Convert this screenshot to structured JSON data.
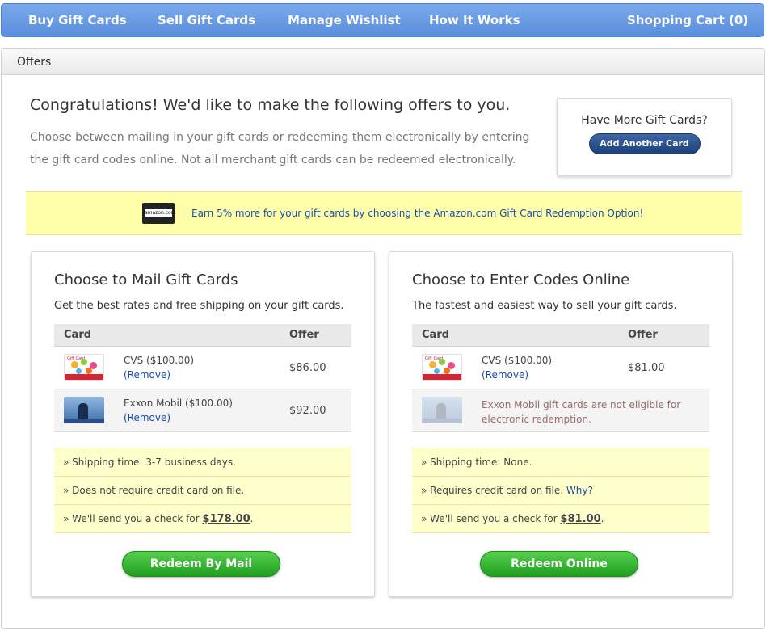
{
  "nav": {
    "buy": "Buy Gift Cards",
    "sell": "Sell Gift Cards",
    "wishlist": "Manage Wishlist",
    "how": "How It Works",
    "cart": "Shopping Cart (0)"
  },
  "panel_title": "Offers",
  "headline": "Congratulations! We'd like to make the following offers to you.",
  "intro": "Choose between mailing in your gift cards or redeeming them electronically by entering the gift card codes online. Not all merchant gift cards can be redeemed electronically.",
  "more_cards": {
    "title": "Have More Gift Cards?",
    "button": "Add Another Card"
  },
  "promo": {
    "logo_text": "amazon.com",
    "text": "Earn 5% more for your gift cards by choosing the Amazon.com Gift Card Redemption Option!"
  },
  "mail": {
    "title": "Choose to Mail Gift Cards",
    "subtitle": "Get the best rates and free shipping on your gift cards.",
    "col_card": "Card",
    "col_offer": "Offer",
    "rows": [
      {
        "name": "CVS ($100.00)",
        "remove": "(Remove)",
        "offer": "$86.00"
      },
      {
        "name": "Exxon Mobil ($100.00)",
        "remove": "(Remove)",
        "offer": "$92.00"
      }
    ],
    "info": {
      "shipping": "» Shipping time: 3-7 business days.",
      "credit": "» Does not require credit card on file.",
      "check_prefix": "» We'll send you a check for ",
      "check_amount": "$178.00",
      "check_suffix": "."
    },
    "button": "Redeem By Mail"
  },
  "online": {
    "title": "Choose to Enter Codes Online",
    "subtitle": "The fastest and easiest way to sell your gift cards.",
    "col_card": "Card",
    "col_offer": "Offer",
    "rows": [
      {
        "name": "CVS ($100.00)",
        "remove": "(Remove)",
        "offer": "$81.00"
      },
      {
        "message": "Exxon Mobil gift cards are not eligible for electronic redemption."
      }
    ],
    "info": {
      "shipping": "» Shipping time: None.",
      "credit": "» Requires credit card on file. ",
      "why": "Why?",
      "check_prefix": "» We'll send you a check for ",
      "check_amount": "$81.00",
      "check_suffix": "."
    },
    "button": "Redeem Online"
  },
  "colors": {
    "nav_blue": "#5a8fdd",
    "link_blue": "#1a4cae",
    "promo_yellow": "#ffffaa",
    "button_green": "#1f9e1f",
    "button_navy": "#1c3f78"
  }
}
